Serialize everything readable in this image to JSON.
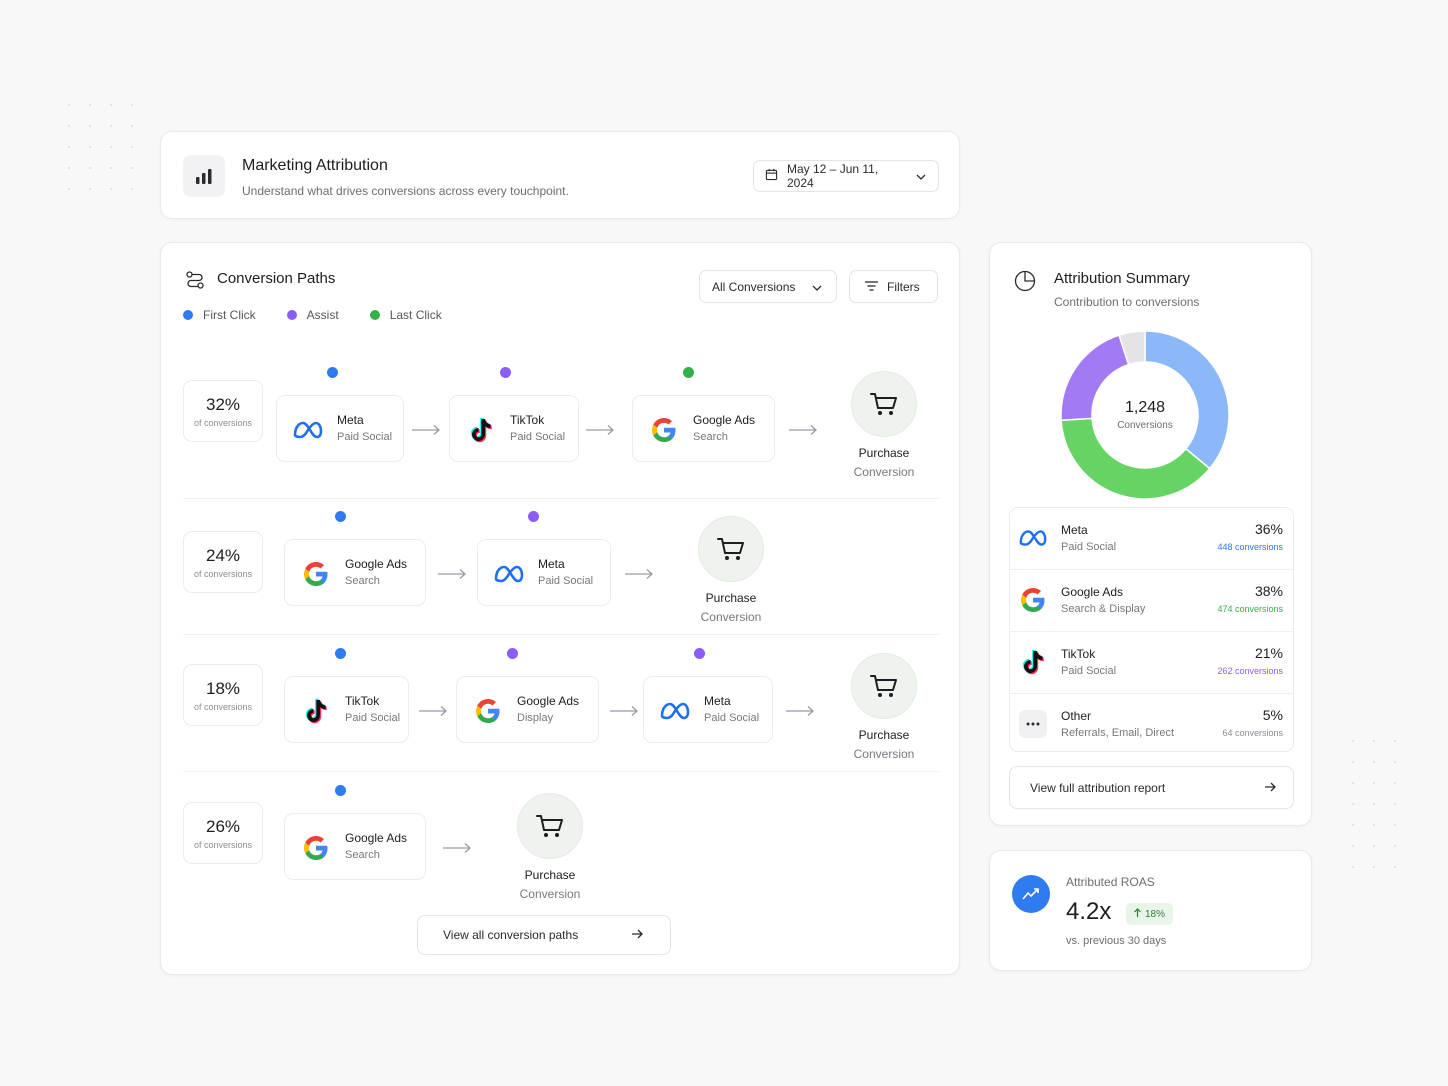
{
  "header": {
    "title": "Marketing Attribution",
    "subtitle": "Understand what drives conversions across every touchpoint.",
    "date_range": "May 12 – Jun 11, 2024"
  },
  "paths": {
    "title": "Conversion Paths",
    "filter_select": "All Conversions",
    "filters_label": "Filters",
    "legend": [
      {
        "label": "First Click",
        "color": "#2f7bf0"
      },
      {
        "label": "Assist",
        "color": "#8b5cf6"
      },
      {
        "label": "Last Click",
        "color": "#34b04a"
      }
    ],
    "pct_label": "of conversions",
    "dest": {
      "name": "Purchase",
      "sub": "Conversion"
    },
    "rows": [
      {
        "pct": "32%",
        "nodes": [
          {
            "name": "Meta",
            "type": "Paid Social",
            "logo": "meta-icon"
          },
          {
            "name": "TikTok",
            "type": "Paid Social",
            "logo": "tiktok-icon"
          },
          {
            "name": "Google Ads",
            "type": "Search",
            "logo": "google-icon"
          }
        ]
      },
      {
        "pct": "24%",
        "nodes": [
          {
            "name": "Google Ads",
            "type": "Search",
            "logo": "google-icon"
          },
          {
            "name": "Meta",
            "type": "Paid Social",
            "logo": "meta-icon"
          }
        ]
      },
      {
        "pct": "18%",
        "nodes": [
          {
            "name": "TikTok",
            "type": "Paid Social",
            "logo": "tiktok-icon"
          },
          {
            "name": "Google Ads",
            "type": "Display",
            "logo": "google-icon"
          },
          {
            "name": "Meta",
            "type": "Paid Social",
            "logo": "meta-icon"
          }
        ]
      },
      {
        "pct": "26%",
        "nodes": [
          {
            "name": "Google Ads",
            "type": "Search",
            "logo": "google-icon"
          }
        ]
      }
    ],
    "view_all": "View all conversion paths"
  },
  "summary": {
    "title": "Attribution Summary",
    "subtitle": "Contribution to conversions",
    "total": "1,248",
    "total_label": "Conversions",
    "sources": [
      {
        "name": "Meta",
        "type": "Paid Social",
        "pct": "36%",
        "conv": "448 conversions",
        "color": "#2f7bf0"
      },
      {
        "name": "Google Ads",
        "type": "Search & Display",
        "pct": "38%",
        "conv": "474 conversions",
        "color": "#34b04a"
      },
      {
        "name": "TikTok",
        "type": "Paid Social",
        "pct": "21%",
        "conv": "262 conversions",
        "color": "#8b5cf6"
      },
      {
        "name": "Other",
        "type": "Referrals, Email, Direct",
        "pct": "5%",
        "conv": "64 conversions",
        "color": "#8b8b94"
      }
    ],
    "donut": [
      {
        "value": 36,
        "color": "#8bb8f8"
      },
      {
        "value": 38,
        "color": "#66d365"
      },
      {
        "value": 21,
        "color": "#a27bf4"
      },
      {
        "value": 5,
        "color": "#e4e4e8"
      }
    ],
    "report_link": "View full attribution report"
  },
  "roas": {
    "label": "Attributed ROAS",
    "value": "4.2x",
    "change": "18%",
    "sub": "vs. previous 30 days"
  }
}
